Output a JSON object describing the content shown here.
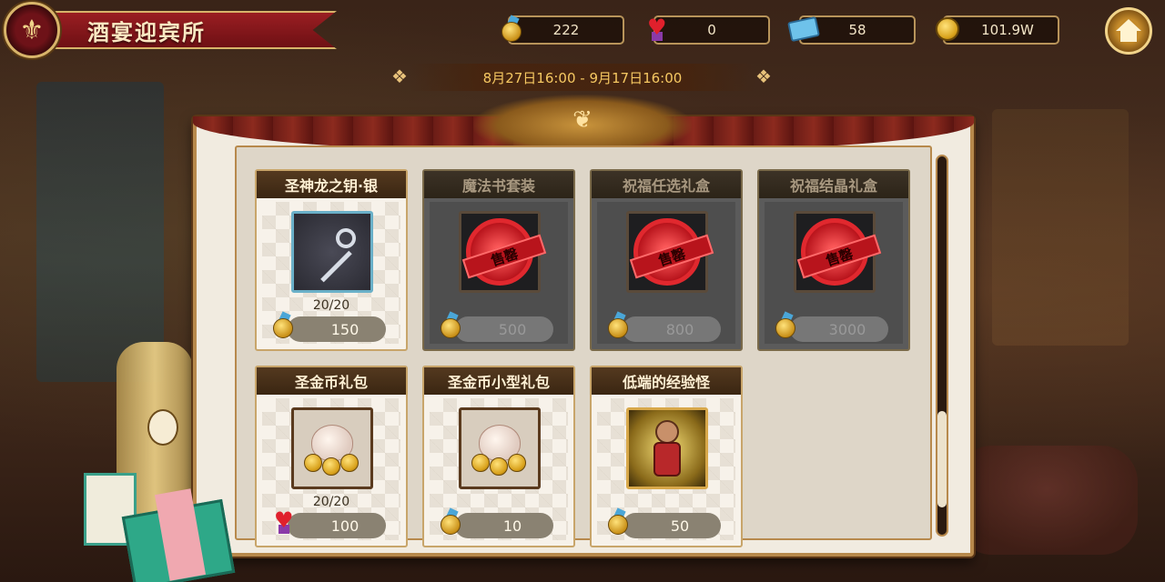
{
  "header": {
    "title": "酒宴迎宾所"
  },
  "currencies": [
    {
      "name": "medal-coin",
      "value": "222",
      "icon": "medal-coin-icon"
    },
    {
      "name": "heart",
      "value": "0",
      "icon": "heart-medal-icon"
    },
    {
      "name": "ticket",
      "value": "58",
      "icon": "ticket-icon"
    },
    {
      "name": "gold",
      "value": "101.9W",
      "icon": "gold-coin-icon"
    }
  ],
  "event": {
    "date_range": "8月27日16:00 - 9月17日16:00"
  },
  "items": [
    {
      "title": "圣神龙之钥·银",
      "stock": "20/20",
      "price": "150",
      "currency_icon": "medal-coin-icon",
      "sold_out": false,
      "image": "silver-key-icon"
    },
    {
      "title": "魔法书套装",
      "stock": "",
      "price": "500",
      "currency_icon": "medal-coin-icon",
      "sold_out": true,
      "stamp": "售罄",
      "image": "sold-out-stamp-icon"
    },
    {
      "title": "祝福任选礼盒",
      "stock": "",
      "price": "800",
      "currency_icon": "medal-coin-icon",
      "sold_out": true,
      "stamp": "售罄",
      "image": "sold-out-stamp-icon"
    },
    {
      "title": "祝福结晶礼盒",
      "stock": "",
      "price": "3000",
      "currency_icon": "medal-coin-icon",
      "sold_out": true,
      "stamp": "售罄",
      "image": "sold-out-stamp-icon"
    },
    {
      "title": "圣金币礼包",
      "stock": "20/20",
      "price": "100",
      "currency_icon": "heart-medal-icon",
      "sold_out": false,
      "image": "coin-bag-icon"
    },
    {
      "title": "圣金币小型礼包",
      "stock": "",
      "price": "10",
      "currency_icon": "medal-coin-icon",
      "sold_out": false,
      "image": "coin-bag-icon"
    },
    {
      "title": "低端的经验怪",
      "stock": "",
      "price": "50",
      "currency_icon": "medal-coin-icon",
      "sold_out": false,
      "image": "exp-monster-icon"
    }
  ],
  "colors": {
    "banner_red": "#9a1e22",
    "gold_trim": "#d8b46a",
    "date_text": "#f6c862",
    "stamp_red": "#e0282e"
  }
}
